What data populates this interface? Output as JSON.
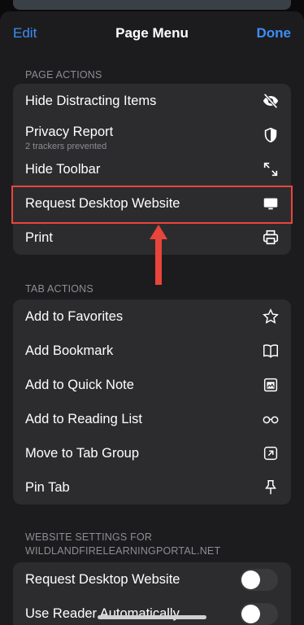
{
  "nav": {
    "edit_label": "Edit",
    "title": "Page Menu",
    "done_label": "Done"
  },
  "page_actions": {
    "header": "PAGE ACTIONS",
    "items": [
      {
        "label": "Hide Distracting Items",
        "icon": "eye-slash-icon"
      },
      {
        "label": "Privacy Report",
        "sublabel": "2 trackers prevented",
        "icon": "shield-icon"
      },
      {
        "label": "Hide Toolbar",
        "icon": "diagonal-arrows-icon"
      },
      {
        "label": "Request Desktop Website",
        "icon": "desktop-icon"
      },
      {
        "label": "Print",
        "icon": "printer-icon"
      }
    ]
  },
  "tab_actions": {
    "header": "TAB ACTIONS",
    "items": [
      {
        "label": "Add to Favorites",
        "icon": "star-icon"
      },
      {
        "label": "Add Bookmark",
        "icon": "book-icon"
      },
      {
        "label": "Add to Quick Note",
        "icon": "quick-note-icon"
      },
      {
        "label": "Add to Reading List",
        "icon": "glasses-icon"
      },
      {
        "label": "Move to Tab Group",
        "icon": "move-arrow-icon"
      },
      {
        "label": "Pin Tab",
        "icon": "pin-icon"
      }
    ]
  },
  "website_settings": {
    "header_line1": "WEBSITE SETTINGS FOR",
    "header_line2": "WILDLANDFIRELEARNINGPORTAL.NET",
    "items": [
      {
        "label": "Request Desktop Website",
        "toggle": false
      },
      {
        "label": "Use Reader Automatically",
        "toggle": false
      }
    ]
  },
  "annotation": {
    "color": "#e8453c"
  },
  "colors": {
    "accent": "#3d8ef5",
    "sheet": "#1c1c1e",
    "cell": "#2c2c2e"
  }
}
